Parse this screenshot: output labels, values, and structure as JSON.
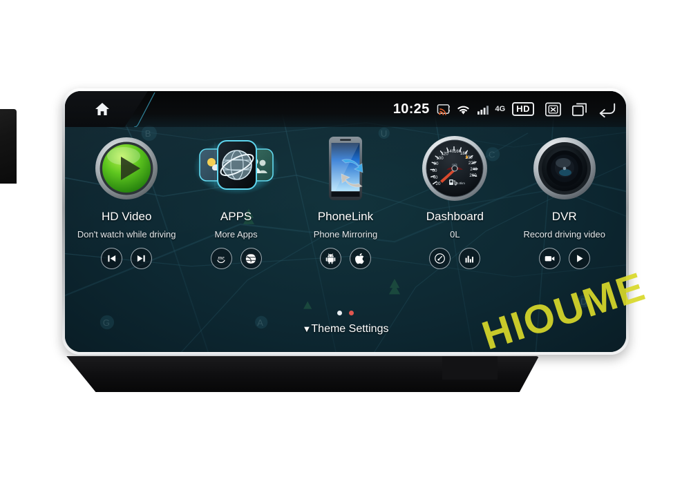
{
  "status_bar": {
    "home_icon": "home-icon",
    "clock": "10:25",
    "cast_icon": "cast-icon",
    "wifi_icon": "wifi-icon",
    "signal_icon": "cellular-signal-icon",
    "network_label": "4G",
    "hd_badge": "HD",
    "close_icon": "close-boxed-icon",
    "recents_icon": "recent-apps-icon",
    "back_icon": "back-arrow-icon"
  },
  "apps": [
    {
      "id": "hd-video",
      "title": "HD Video",
      "subtitle": "Don't watch while driving",
      "icon": "green-play-button-icon",
      "actions": [
        {
          "id": "previous-track",
          "icon": "previous-track-icon"
        },
        {
          "id": "next-track",
          "icon": "next-track-icon"
        }
      ]
    },
    {
      "id": "apps",
      "title": "APPS",
      "subtitle": "More Apps",
      "icon": "globe-browser-icon",
      "actions": [
        {
          "id": "me-account",
          "icon": "me-icon"
        },
        {
          "id": "browser",
          "icon": "globe-icon"
        }
      ]
    },
    {
      "id": "phonelink",
      "title": "PhoneLink",
      "subtitle": "Phone Mirroring",
      "icon": "phone-mirroring-icon",
      "actions": [
        {
          "id": "android-link",
          "icon": "android-icon"
        },
        {
          "id": "apple-link",
          "icon": "apple-icon"
        }
      ]
    },
    {
      "id": "dashboard",
      "title": "Dashboard",
      "subtitle": "0L",
      "icon": "speedometer-gauge-icon",
      "actions": [
        {
          "id": "gauge-view",
          "icon": "gauge-icon"
        },
        {
          "id": "stats-view",
          "icon": "bar-chart-icon"
        }
      ]
    },
    {
      "id": "dvr",
      "title": "DVR",
      "subtitle": "Record driving video",
      "icon": "camera-lens-icon",
      "actions": [
        {
          "id": "record-video",
          "icon": "video-camera-icon"
        },
        {
          "id": "play-recording",
          "icon": "play-icon"
        }
      ]
    }
  ],
  "footer": {
    "page_dots": [
      {
        "active": false,
        "color": "#e8eef2"
      },
      {
        "active": true,
        "color": "#e0574f"
      }
    ],
    "theme_settings_caret": "▼",
    "theme_settings_label": "Theme Settings"
  },
  "watermark": {
    "text": "HIOUME",
    "color": "#d9d92a"
  },
  "gauge": {
    "unit": "km/h",
    "ticks": [
      "20",
      "40",
      "60",
      "80",
      "100",
      "120",
      "140",
      "160",
      "180",
      "200",
      "220",
      "240",
      "260"
    ]
  }
}
